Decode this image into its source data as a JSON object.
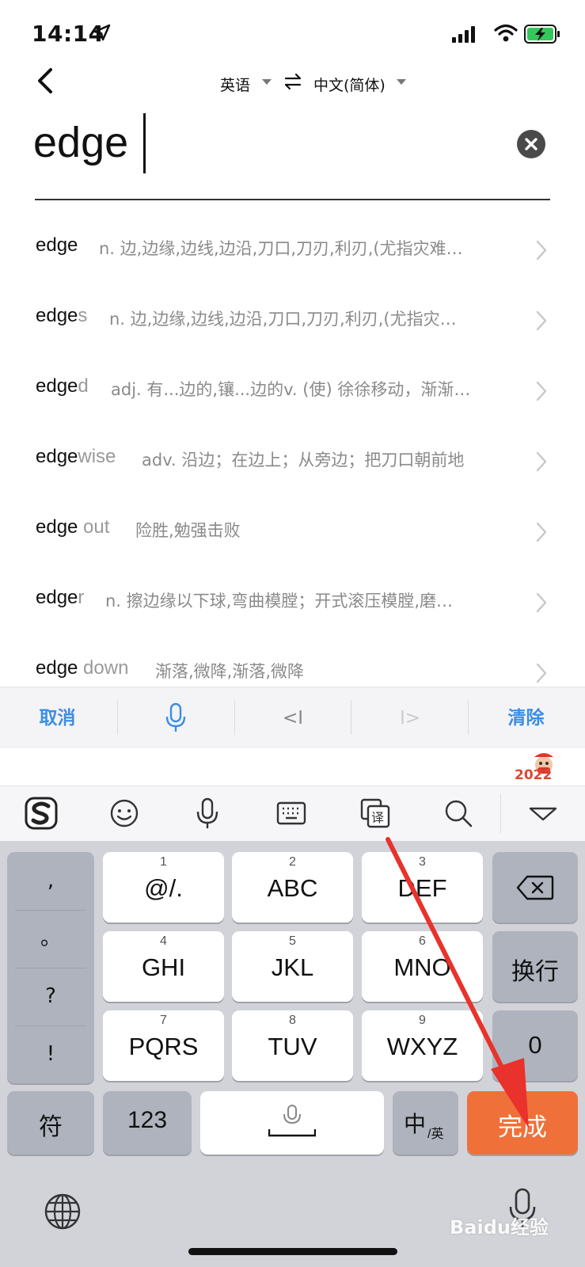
{
  "status_bar": {
    "time": "14:14"
  },
  "header": {
    "lang_from": "英语",
    "lang_to": "中文(简体)"
  },
  "search": {
    "value": "edge"
  },
  "results": [
    {
      "match": "edge",
      "rest": "",
      "def": "n. 边,边缘,边线,边沿,刀口,刀刃,利刃,(尤指灾难…"
    },
    {
      "match": "edge",
      "rest": "s",
      "def": "n. 边,边缘,边线,边沿,刀口,刀刃,利刃,(尤指灾…"
    },
    {
      "match": "edge",
      "rest": "d",
      "def": "adj. 有...边的,镶...边的v. (使) 徐徐移动，渐渐…"
    },
    {
      "match": "edge",
      "rest": "wise",
      "def": "adv. 沿边；在边上；从旁边；把刀口朝前地"
    },
    {
      "match": "edge",
      "rest": " out",
      "def": "险胜,勉强击败"
    },
    {
      "match": "edge",
      "rest": "r",
      "def": "n. 擦边缘以下球,弯曲模膛；开式滚压模膛,磨…"
    },
    {
      "match": "edge",
      "rest": " down",
      "def": "渐落,微降,渐落,微降"
    }
  ],
  "toolbar": {
    "cancel": "取消",
    "cursor_left": "<I",
    "cursor_right": "I>",
    "clear": "清除"
  },
  "ime": {
    "badge_year": "2022",
    "icons": [
      "sogou-logo-icon",
      "emoji-icon",
      "microphone-icon",
      "keyboard-icon",
      "translate-icon",
      "search-icon",
      "collapse-icon"
    ]
  },
  "keyboard": {
    "punct": [
      ",",
      "。",
      "?",
      "!"
    ],
    "keys": [
      {
        "num": "1",
        "label": "@/."
      },
      {
        "num": "2",
        "label": "ABC"
      },
      {
        "num": "3",
        "label": "DEF"
      },
      {
        "num": "4",
        "label": "GHI"
      },
      {
        "num": "5",
        "label": "JKL"
      },
      {
        "num": "6",
        "label": "MNO"
      },
      {
        "num": "7",
        "label": "PQRS"
      },
      {
        "num": "8",
        "label": "TUV"
      },
      {
        "num": "9",
        "label": "WXYZ"
      }
    ],
    "newline": "换行",
    "zero": "0",
    "symbols": "符",
    "numbers": "123",
    "lang_switch_main": "中",
    "lang_switch_sub": "/英",
    "done": "完成"
  },
  "watermark": "Baidu经验",
  "colors": {
    "accent_blue": "#3b8ee4",
    "done_orange": "#f0703a",
    "annotation_red": "#e8322b"
  }
}
